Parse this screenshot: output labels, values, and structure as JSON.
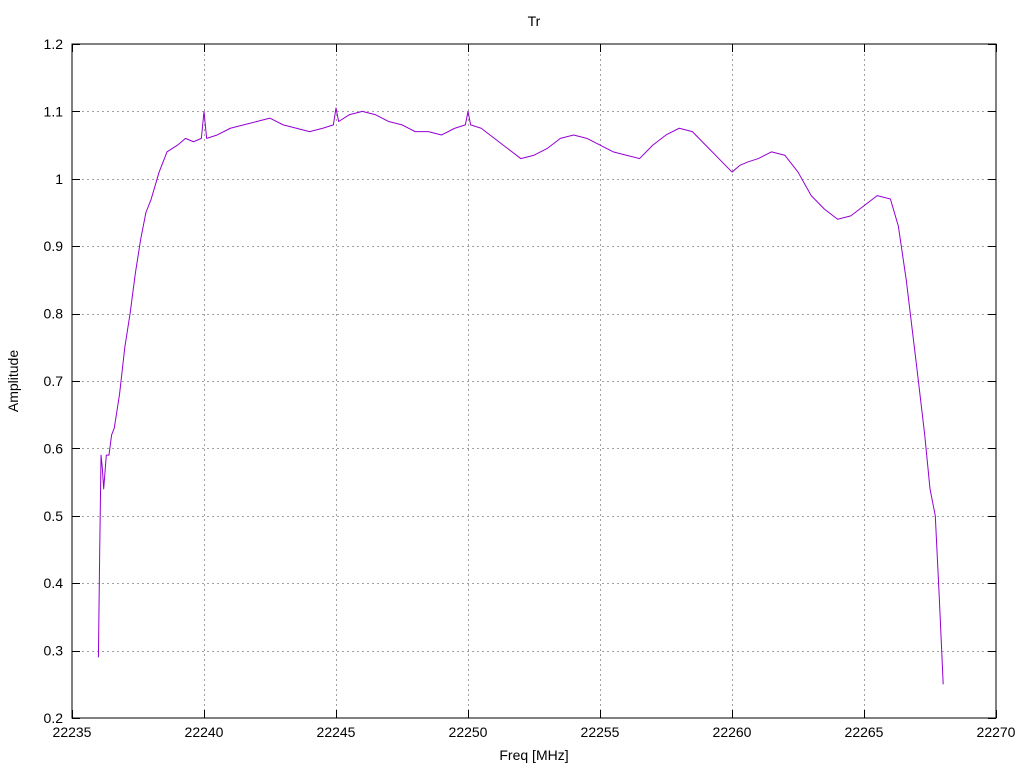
{
  "chart_data": {
    "type": "line",
    "title": "Tr",
    "xlabel": "Freq [MHz]",
    "ylabel": "Amplitude",
    "xlim": [
      22235,
      22270
    ],
    "ylim": [
      0.2,
      1.2
    ],
    "x_ticks": [
      22235,
      22240,
      22245,
      22250,
      22255,
      22260,
      22265,
      22270
    ],
    "x_tick_labels": [
      "22235",
      "22240",
      "22245",
      "22250",
      "22255",
      "22260",
      "22265",
      "22270"
    ],
    "y_ticks": [
      0.2,
      0.3,
      0.4,
      0.5,
      0.6,
      0.7,
      0.8,
      0.9,
      1.0,
      1.1,
      1.2
    ],
    "y_tick_labels": [
      "0.2",
      "0.3",
      "0.4",
      "0.5",
      "0.6",
      "0.7",
      "0.8",
      "0.9",
      "1",
      "1.1",
      "1.2"
    ],
    "grid": true,
    "legend": "none",
    "series": [
      {
        "color": "#9400d3",
        "x": [
          22236.0,
          22236.05,
          22236.1,
          22236.15,
          22236.2,
          22236.3,
          22236.4,
          22236.5,
          22236.6,
          22236.8,
          22237.0,
          22237.2,
          22237.4,
          22237.6,
          22237.8,
          22238.0,
          22238.3,
          22238.6,
          22239.0,
          22239.3,
          22239.6,
          22239.9,
          22240.0,
          22240.1,
          22240.5,
          22241.0,
          22241.5,
          22242.0,
          22242.5,
          22243.0,
          22243.5,
          22244.0,
          22244.5,
          22244.9,
          22245.0,
          22245.1,
          22245.5,
          22246.0,
          22246.5,
          22247.0,
          22247.5,
          22248.0,
          22248.5,
          22249.0,
          22249.5,
          22249.9,
          22250.0,
          22250.1,
          22250.5,
          22251.0,
          22251.5,
          22252.0,
          22252.5,
          22253.0,
          22253.5,
          22254.0,
          22254.5,
          22255.0,
          22255.5,
          22256.0,
          22256.5,
          22257.0,
          22257.5,
          22258.0,
          22258.5,
          22259.0,
          22259.5,
          22260.0,
          22260.3,
          22260.6,
          22261.0,
          22261.5,
          22262.0,
          22262.5,
          22263.0,
          22263.5,
          22264.0,
          22264.5,
          22265.0,
          22265.5,
          22266.0,
          22266.3,
          22266.6,
          22267.0,
          22267.3,
          22267.5,
          22267.7,
          22267.85,
          22268.0
        ],
        "y": [
          0.29,
          0.45,
          0.59,
          0.57,
          0.54,
          0.59,
          0.59,
          0.62,
          0.63,
          0.68,
          0.75,
          0.8,
          0.86,
          0.91,
          0.95,
          0.97,
          1.01,
          1.04,
          1.05,
          1.06,
          1.055,
          1.06,
          1.1,
          1.06,
          1.065,
          1.075,
          1.08,
          1.085,
          1.09,
          1.08,
          1.075,
          1.07,
          1.075,
          1.08,
          1.105,
          1.085,
          1.095,
          1.1,
          1.095,
          1.085,
          1.08,
          1.07,
          1.07,
          1.065,
          1.075,
          1.08,
          1.1,
          1.08,
          1.075,
          1.06,
          1.045,
          1.03,
          1.035,
          1.045,
          1.06,
          1.065,
          1.06,
          1.05,
          1.04,
          1.035,
          1.03,
          1.05,
          1.065,
          1.075,
          1.07,
          1.05,
          1.03,
          1.01,
          1.02,
          1.025,
          1.03,
          1.04,
          1.035,
          1.01,
          0.975,
          0.955,
          0.94,
          0.945,
          0.96,
          0.975,
          0.97,
          0.93,
          0.85,
          0.72,
          0.62,
          0.54,
          0.5,
          0.38,
          0.25
        ]
      }
    ]
  }
}
